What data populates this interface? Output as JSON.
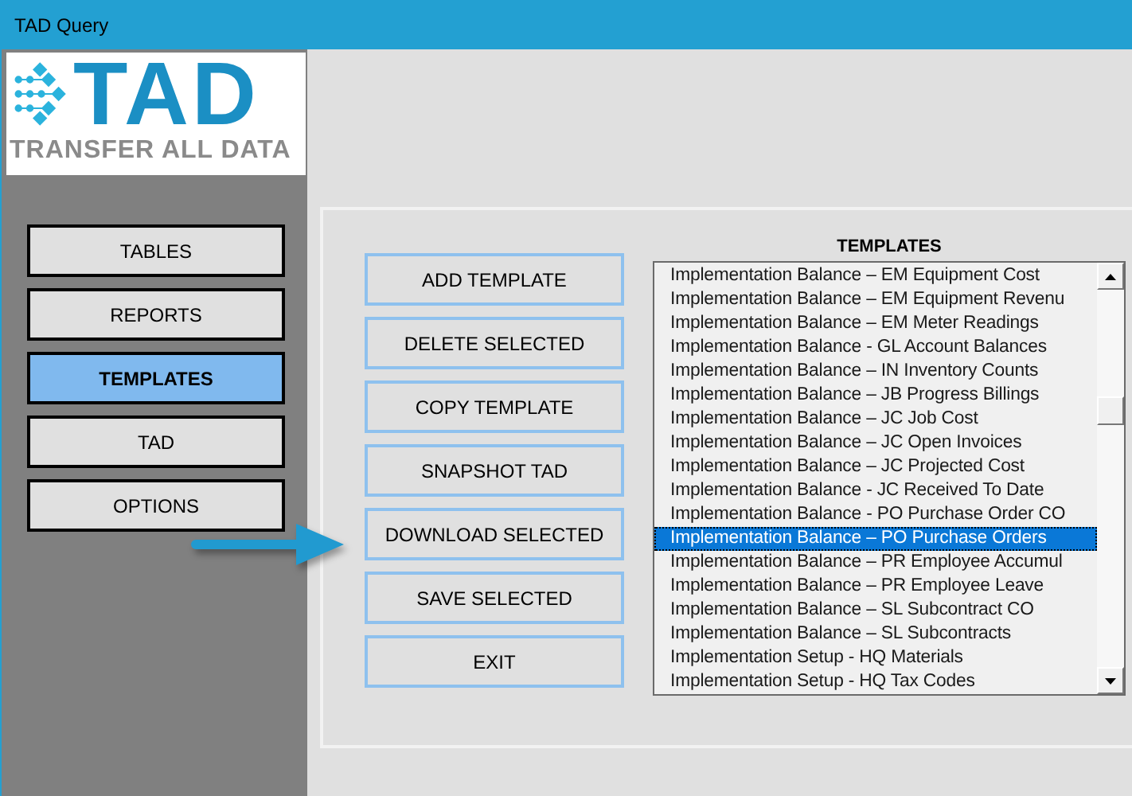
{
  "window": {
    "title": "TAD Query"
  },
  "logo": {
    "name": "TAD",
    "tagline": "TRANSFER ALL DATA"
  },
  "nav": [
    {
      "label": "TABLES",
      "selected": false
    },
    {
      "label": "REPORTS",
      "selected": false
    },
    {
      "label": "TEMPLATES",
      "selected": true
    },
    {
      "label": "TAD",
      "selected": false
    },
    {
      "label": "OPTIONS",
      "selected": false
    }
  ],
  "actions": [
    "ADD TEMPLATE",
    "DELETE SELECTED",
    "COPY TEMPLATE",
    "SNAPSHOT TAD",
    "DOWNLOAD SELECTED",
    "SAVE SELECTED",
    "EXIT"
  ],
  "templates": {
    "title": "TEMPLATES",
    "items": [
      {
        "label": "Implementation Balance – EM Equipment Cost",
        "selected": false
      },
      {
        "label": "Implementation Balance – EM Equipment Revenu",
        "selected": false
      },
      {
        "label": "Implementation Balance – EM Meter Readings",
        "selected": false
      },
      {
        "label": "Implementation Balance - GL Account Balances",
        "selected": false
      },
      {
        "label": "Implementation Balance – IN Inventory Counts",
        "selected": false
      },
      {
        "label": "Implementation Balance – JB Progress Billings",
        "selected": false
      },
      {
        "label": "Implementation Balance – JC Job Cost",
        "selected": false
      },
      {
        "label": "Implementation Balance – JC Open Invoices",
        "selected": false
      },
      {
        "label": "Implementation Balance – JC Projected Cost",
        "selected": false
      },
      {
        "label": "Implementation Balance - JC Received To Date",
        "selected": false
      },
      {
        "label": "Implementation Balance - PO Purchase Order CO",
        "selected": false
      },
      {
        "label": "Implementation Balance – PO Purchase Orders",
        "selected": true
      },
      {
        "label": "Implementation Balance – PR Employee Accumul",
        "selected": false
      },
      {
        "label": "Implementation Balance – PR Employee Leave",
        "selected": false
      },
      {
        "label": "Implementation Balance – SL Subcontract CO",
        "selected": false
      },
      {
        "label": "Implementation Balance – SL Subcontracts",
        "selected": false
      },
      {
        "label": "Implementation Setup - HQ Materials",
        "selected": false
      },
      {
        "label": "Implementation Setup - HQ Tax Codes",
        "selected": false
      }
    ]
  }
}
